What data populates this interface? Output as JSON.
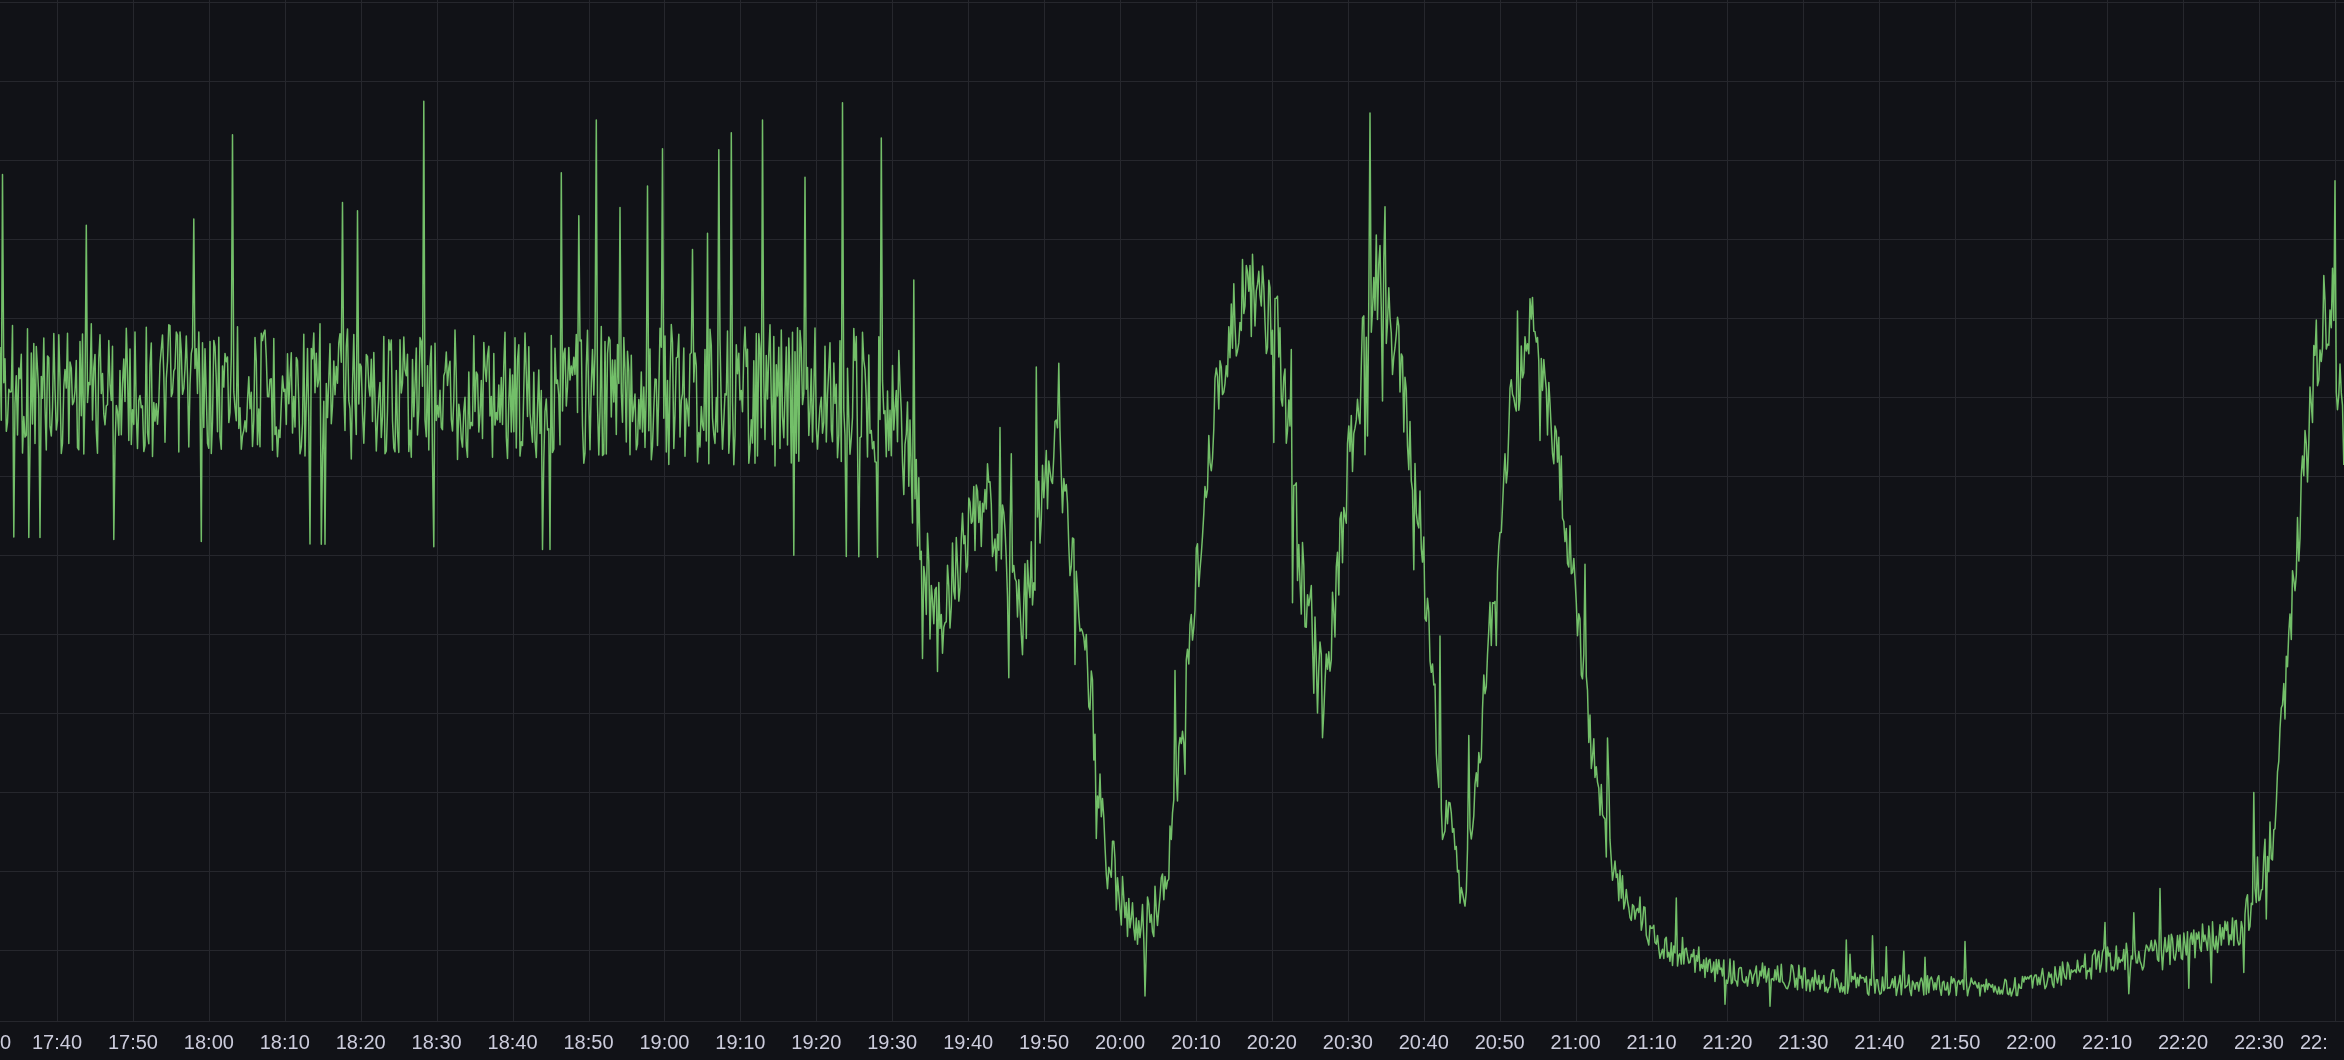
{
  "panel": {
    "kind": "time-series",
    "x_axis": {
      "ticks": [
        "0",
        "17:40",
        "17:50",
        "18:00",
        "18:10",
        "18:20",
        "18:30",
        "18:40",
        "18:50",
        "19:00",
        "19:10",
        "19:20",
        "19:30",
        "19:40",
        "19:50",
        "20:00",
        "20:10",
        "20:20",
        "20:30",
        "20:40",
        "20:50",
        "21:00",
        "21:10",
        "21:20",
        "21:30",
        "21:40",
        "21:50",
        "22:00",
        "22:10",
        "22:20",
        "22:30",
        "22:"
      ]
    }
  }
}
